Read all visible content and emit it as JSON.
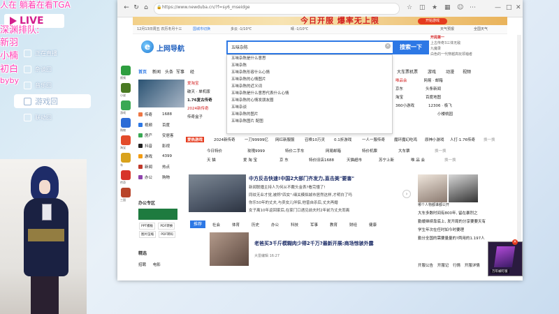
{
  "overlay": {
    "top_text": "人在  躺着在看TGA",
    "live_logo": "LIVE",
    "queue_title": "深渊排队:",
    "queue": [
      "新羽",
      "小楠",
      "初白",
      "byby"
    ],
    "menu": [
      "正在直播",
      "杂谈回",
      "音乐回",
      "游戏回",
      "联动回"
    ],
    "menu_active_index": 3
  },
  "browser": {
    "url": "https://www.newduba.cn/?f=sy6_mseidge",
    "banner_text": "今日开服 爆率无上限",
    "banner_button": "开始游戏",
    "infobar": {
      "date": "12月13日周五 农历冬月十三",
      "city": "国城市切换",
      "weather": "多云 -1/10℃",
      "weather2": "晴 -1/10℃",
      "right": "天气预报",
      "right2": "全国天气"
    },
    "logo_text": "上网导航",
    "search": {
      "value": "五味杂陈",
      "button": "搜索一下",
      "suggestions": [
        "五味杂陈是什么意思",
        "五味杂陈",
        "五味杂陈形容什么心情",
        "五味杂陈的心情图片",
        "五味杂陈的近义词",
        "五味杂陈是什么意思代表什么心情",
        "五味杂陈的心情发朋友圈",
        "五味杂谈",
        "五味杂陈的图片",
        "五味杂陈图片 配图"
      ]
    },
    "right_ad": [
      "开局第一",
      "上古传奇3三体无敌",
      "九魔录",
      "白色的一代穿越高玩领袖者"
    ],
    "left_icons": [
      "视频",
      "小说",
      "游戏",
      "购物",
      "淘宝",
      "车",
      "传奇",
      "三国"
    ],
    "tabs": [
      "首页",
      "新闻",
      "头条",
      "军事",
      "经"
    ],
    "tabs_right": [
      "大车票",
      "机票",
      "游戏",
      "动漫",
      "视频",
      "财经",
      "影音"
    ],
    "hot_box": [
      "爱淘宝",
      "1.76复古传奇",
      "2024新传奇",
      "传奇盒子"
    ],
    "hot_box_head": "破天 · 单机版",
    "nav_grid": [
      [
        "传奇",
        "1688"
      ],
      [
        "视频",
        "百度"
      ],
      [
        "房产",
        "安居客"
      ],
      [
        "抖音",
        "影视"
      ],
      [
        "游戏",
        "4399"
      ],
      [
        "新闻",
        "热点"
      ],
      [
        "办公",
        "购物"
      ]
    ],
    "right_links": [
      [
        "唯品会",
        "网易 · 邮箱"
      ],
      [
        "京东",
        "头条新闻"
      ],
      [
        "淘宝",
        "百度地图"
      ],
      [
        "360小游戏",
        "12306 · 极飞"
      ],
      [
        "",
        "小楼桃园"
      ]
    ],
    "hot_strip_logo": "爱热游戏",
    "hot_strip": [
      "2024新传奇",
      "一刀99999亿",
      "网红新服服",
      "召唤10万灵",
      "0.1折游戏",
      "一人一服传奇",
      "魔环魔幻吃鸡",
      "原神小游戏",
      "人打·1.76传奇",
      "换一换"
    ],
    "link_rows": [
      [
        "今日特价",
        "玫瑰9999",
        "特价二手车",
        "网易邮箱",
        "特价机票",
        "大车票",
        "换一换"
      ],
      [
        "天 猫",
        "爱 淘 宝",
        "京 东",
        "特价旧店1688",
        "天猫超市",
        "苏宁上新",
        "唯 品 会",
        "换一换"
      ]
    ],
    "news": {
      "headline": "中方反击快速!中国2大部门齐发力,直击美\"要害\"",
      "items": [
        "新闻联播主持人为何从不戴头金表?看完懂了!",
        "同纹无业才觉,被称\"四女\":细关模拟城市居然这样,才明白了吗",
        "你乐50年的丈夫,与卖女儿伴侣,他曾自杀后,丈夫再婚",
        "女子离10年返回家后,在家门口遇见前夫时2年前为丈夫而离"
      ],
      "categories": [
        "推荐",
        "社会",
        "体育",
        "历史",
        "办公",
        "科技",
        "军事",
        "教育",
        "财经",
        "健康"
      ],
      "headline2": "老爸买3千斤模糊肉少得2千万?最新开展:商场惊骇外露",
      "tag": "大雷编辑  16:27"
    },
    "right_feature": {
      "caption": "哪个人物都谁都公开",
      "list": [
        "大车多数时间有800年, 留在暴烈之",
        "勤缓继续靠底上, 发开局的分享要要天有",
        "学生年次在任时如今时要理",
        "勤分全国的需要量量的?两用的1.197人"
      ]
    },
    "bottom_links": [
      "开服公告",
      "开服记",
      "行情",
      "开服详情"
    ],
    "left_panel": {
      "title": "办公专区",
      "buttons": [
        "PPT模板",
        "PDF转换",
        "图片压缩",
        "PDF转码"
      ],
      "title2": "精选",
      "links": [
        "招聘",
        "电影"
      ]
    },
    "popup_label": "万年被盯版"
  }
}
